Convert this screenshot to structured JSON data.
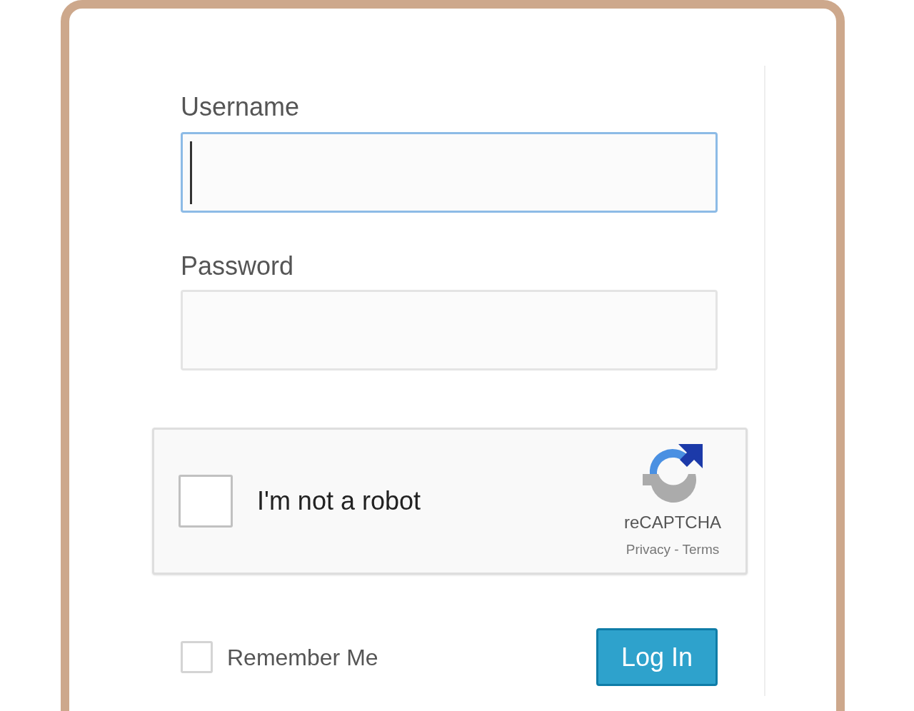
{
  "username": {
    "label": "Username",
    "focused": true
  },
  "password": {
    "label": "Password",
    "focused": false
  },
  "captcha": {
    "label": "I'm not a robot",
    "checked": false,
    "brand": "reCAPTCHA",
    "links": "Privacy - Terms"
  },
  "remember": {
    "label": "Remember Me",
    "checked": false
  },
  "login_button": "Log In"
}
